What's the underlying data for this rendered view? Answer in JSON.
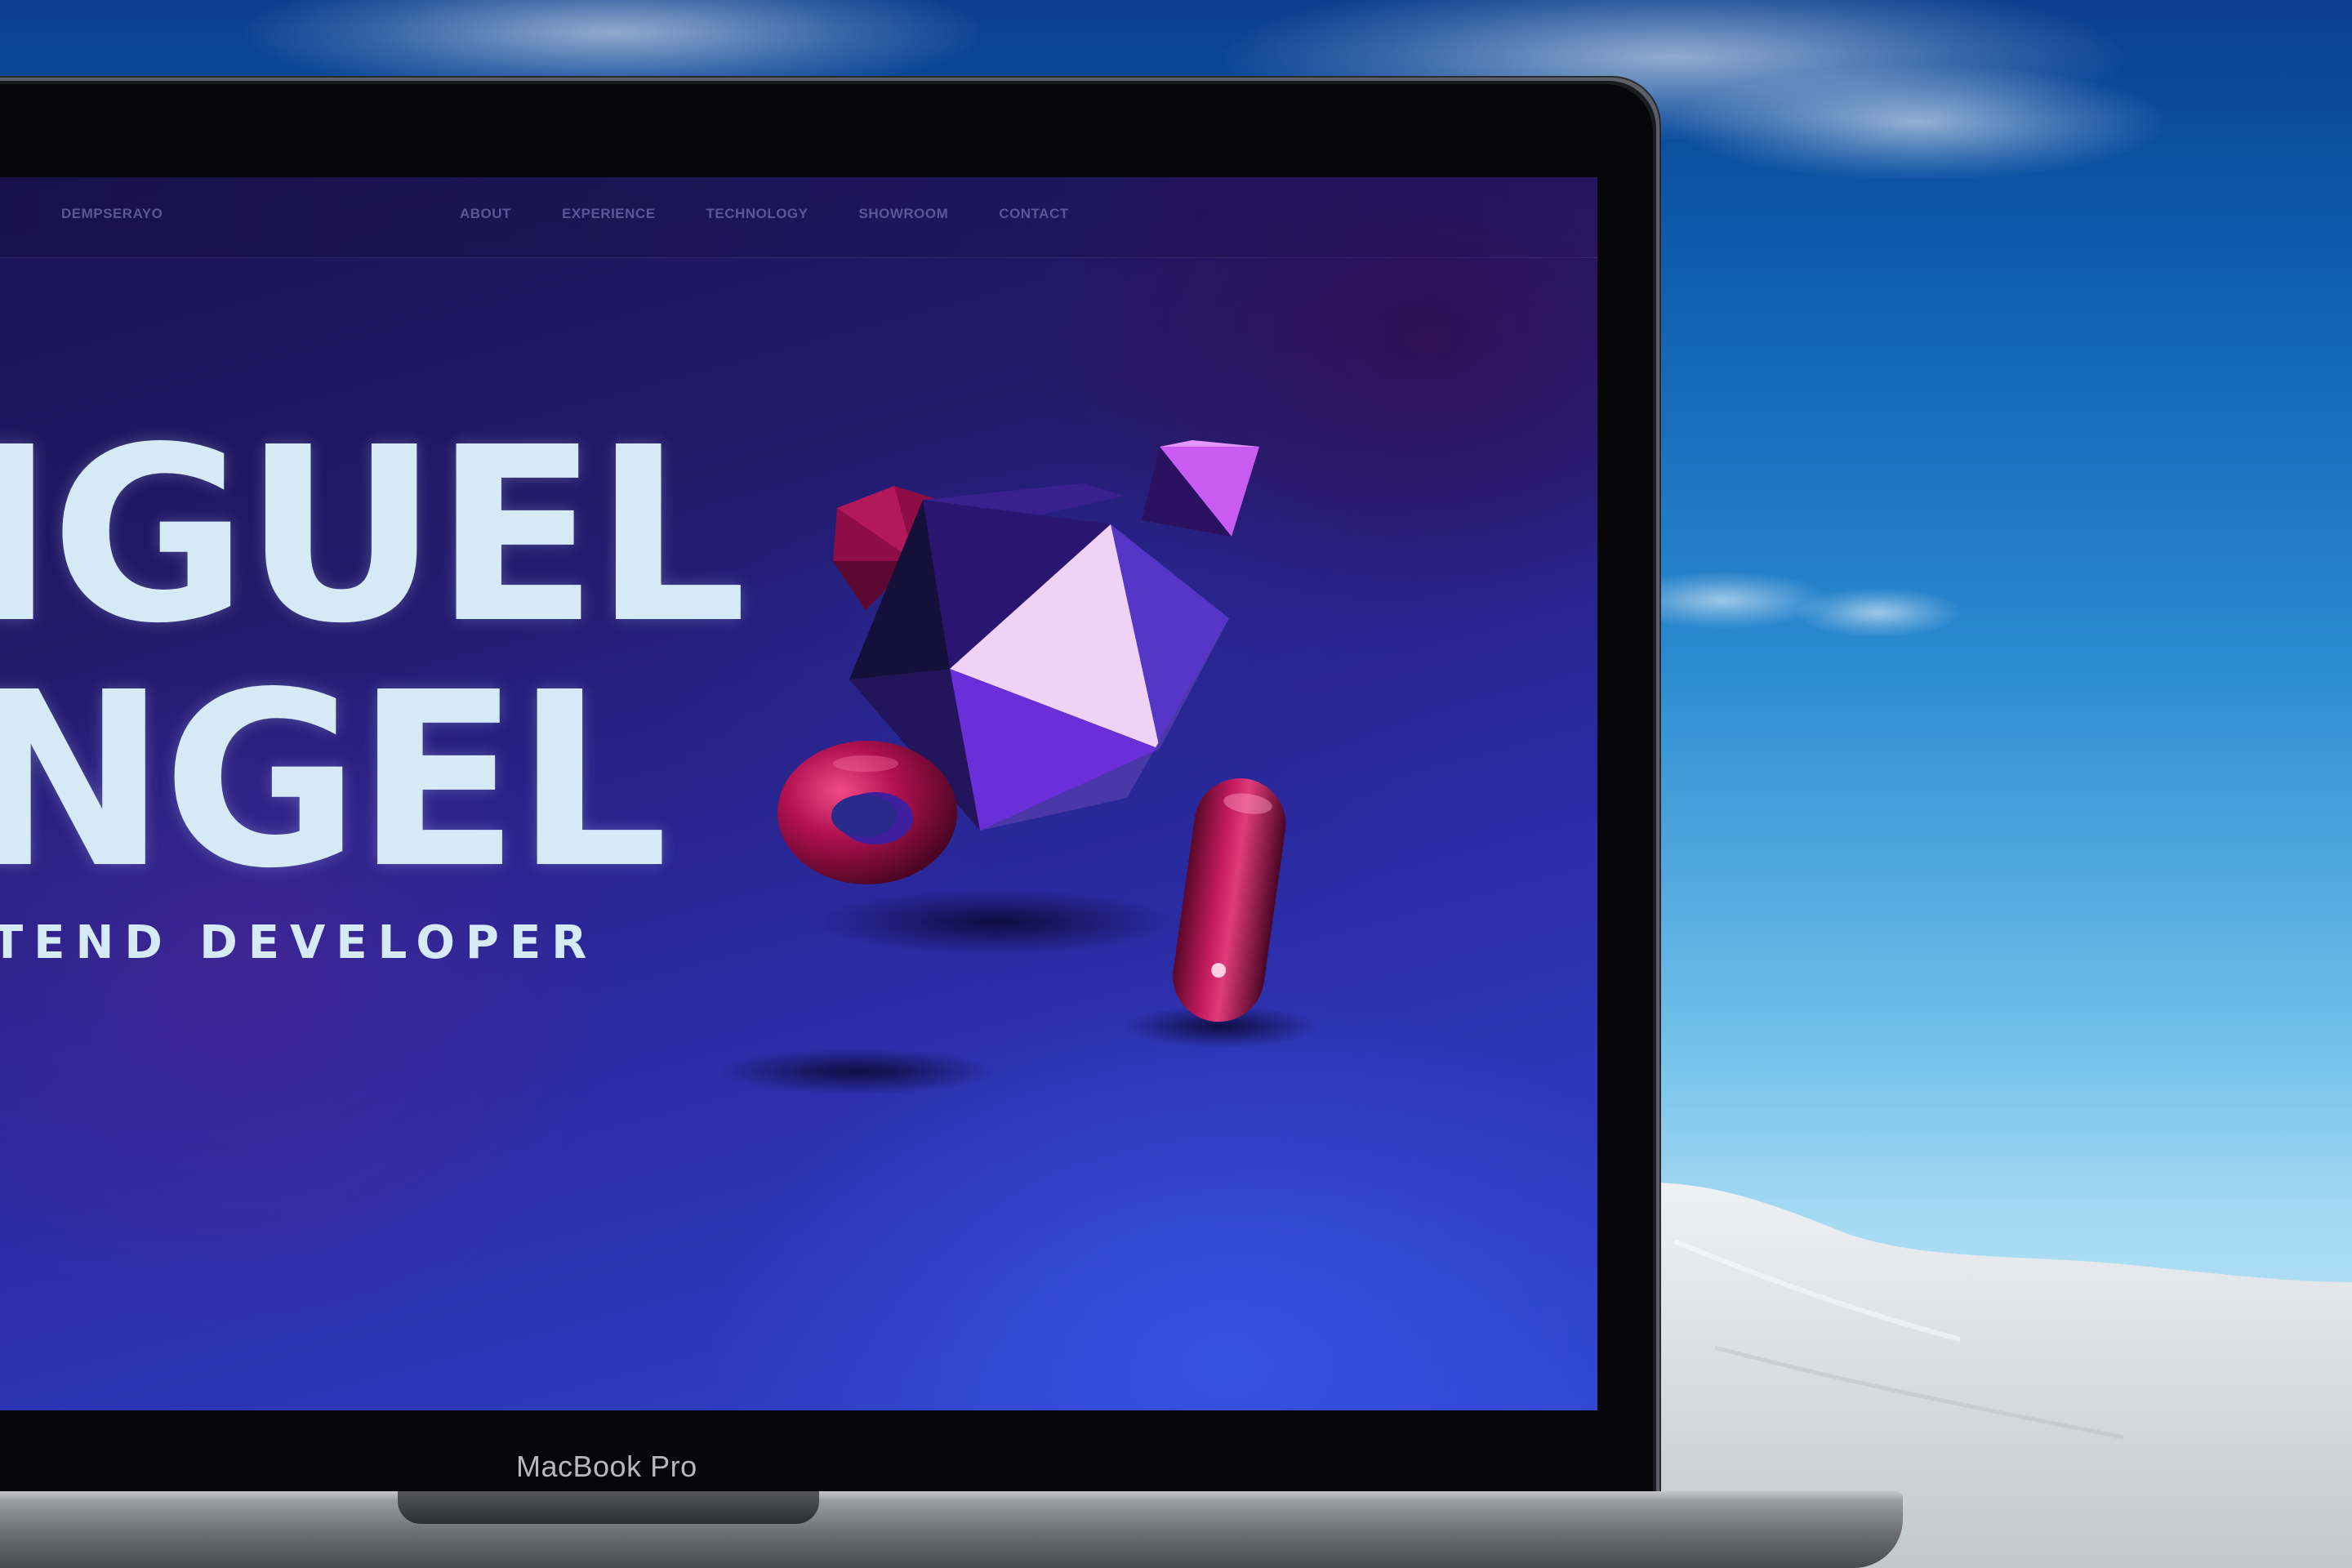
{
  "website": {
    "brand": "DEMPSERAYO",
    "nav": [
      {
        "label": "ABOUT"
      },
      {
        "label": "EXPERIENCE"
      },
      {
        "label": "TECHNOLOGY"
      },
      {
        "label": "SHOWROOM"
      },
      {
        "label": "CONTACT"
      }
    ],
    "hero": {
      "name_line1": "IGUEL",
      "name_line2": "NGEL",
      "role": "TEND DEVELOPER"
    }
  },
  "device": {
    "label": "MacBook Pro"
  },
  "colors": {
    "sky_top": "#0b3f8e",
    "sky_bottom": "#c8e8f7",
    "screen_bg": "#231a6b",
    "hero_text": "#d6eaf5",
    "nav_text": "#5b5694",
    "accent_magenta": "#b0104f",
    "accent_violet": "#6a2fd8"
  }
}
